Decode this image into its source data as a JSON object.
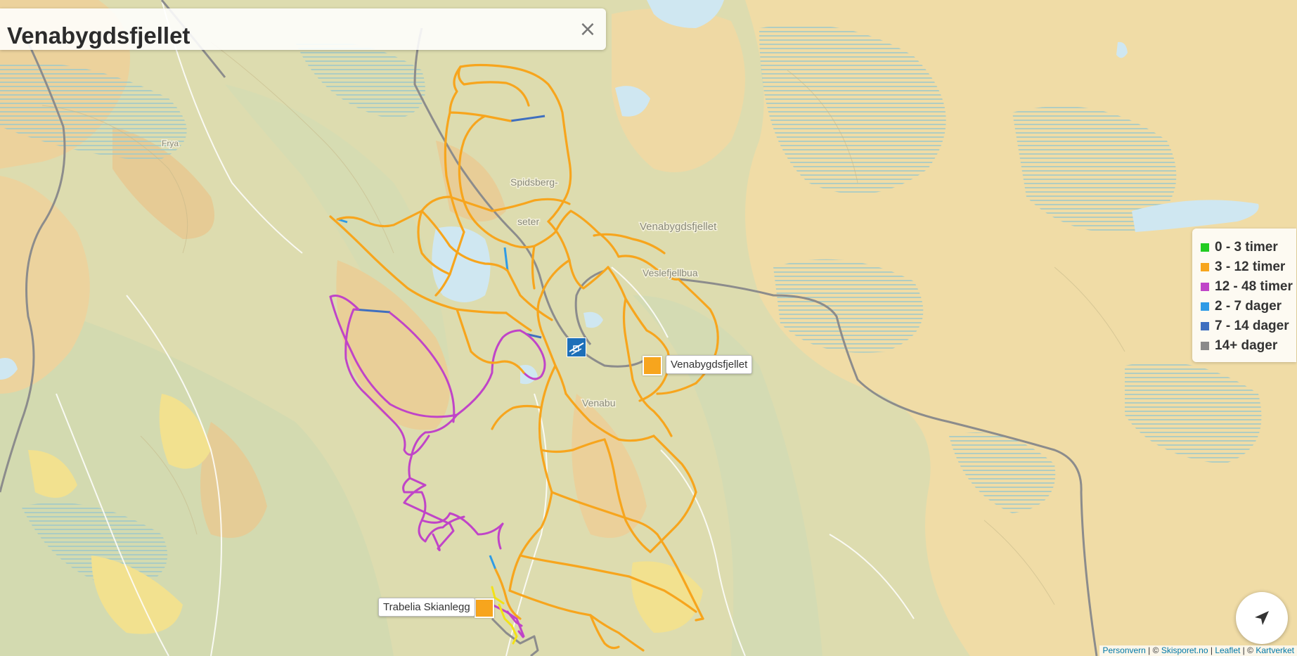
{
  "title_panel": {
    "title": "Venabygdsfjellet",
    "close_label": "×"
  },
  "place_labels": [
    "Frya",
    "Spidsberg-",
    "seter",
    "Venabygdsfjellet",
    "Veslefjellbua",
    "Venabu"
  ],
  "markers": [
    {
      "name": "Venabygdsfjellet",
      "color": "#f7a51d"
    },
    {
      "name": "Trabelia Skianlegg",
      "color": "#f7a51d"
    }
  ],
  "legend": [
    {
      "label": "0 - 3 timer",
      "color": "#22cc22"
    },
    {
      "label": "3 - 12 timer",
      "color": "#f7a51d"
    },
    {
      "label": "12 - 48 timer",
      "color": "#c044c8"
    },
    {
      "label": "2 - 7 dager",
      "color": "#2e9be6"
    },
    {
      "label": "7 - 14 dager",
      "color": "#3f6fbf"
    },
    {
      "label": "14+ dager",
      "color": "#8a8a8a"
    }
  ],
  "attribution": {
    "personvern": "Personvern",
    "sep1": " | © ",
    "skisporet": "Skisporet.no",
    "sep2": " | ",
    "leaflet": "Leaflet",
    "sep3": " | © ",
    "kartverket": "Kartverket"
  },
  "icons": {
    "locate": "navigation-arrow-icon",
    "ski_center": "ski-lift-icon"
  }
}
